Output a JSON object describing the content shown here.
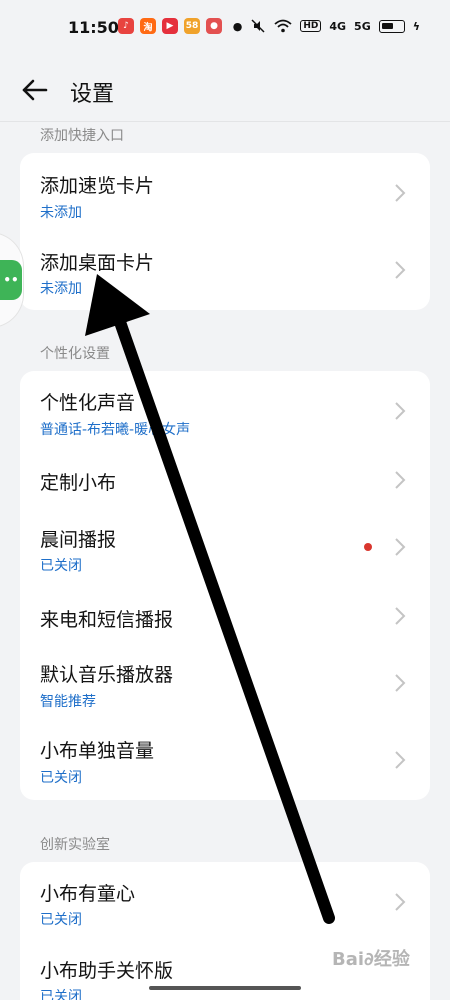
{
  "status_bar": {
    "time": "11:50",
    "apps": [
      {
        "name": "music-app",
        "color": "#e8433f",
        "glyph": "♪"
      },
      {
        "name": "taobao-app",
        "color": "#ff6a13",
        "glyph": "淘"
      },
      {
        "name": "video-app",
        "color": "#e5303c",
        "glyph": "▶"
      },
      {
        "name": "58-app",
        "color": "#f0a22b",
        "glyph": "58"
      },
      {
        "name": "map-app",
        "color": "#e35050",
        "glyph": "●"
      }
    ],
    "indicators": [
      "HD",
      "4G",
      "5G"
    ]
  },
  "header": {
    "title": "设置"
  },
  "sections": {
    "quick": {
      "title": "添加快捷入口",
      "items": [
        {
          "title": "添加速览卡片",
          "sub": "未添加"
        },
        {
          "title": "添加桌面卡片",
          "sub": "未添加"
        }
      ]
    },
    "personal": {
      "title": "个性化设置",
      "items": [
        {
          "title": "个性化声音",
          "sub": "普通话-布若曦-暖心女声"
        },
        {
          "title": "定制小布",
          "sub": ""
        },
        {
          "title": "晨间播报",
          "sub": "已关闭"
        },
        {
          "title": "来电和短信播报",
          "sub": ""
        },
        {
          "title": "默认音乐播放器",
          "sub": "智能推荐"
        },
        {
          "title": "小布单独音量",
          "sub": "已关闭"
        }
      ]
    },
    "lab": {
      "title": "创新实验室",
      "items": [
        {
          "title": "小布有童心",
          "sub": "已关闭"
        },
        {
          "title": "小布助手关怀版",
          "sub": "已关闭"
        }
      ]
    }
  },
  "float_handle": {
    "glyph": "••"
  },
  "watermark": "Bai∂经验"
}
